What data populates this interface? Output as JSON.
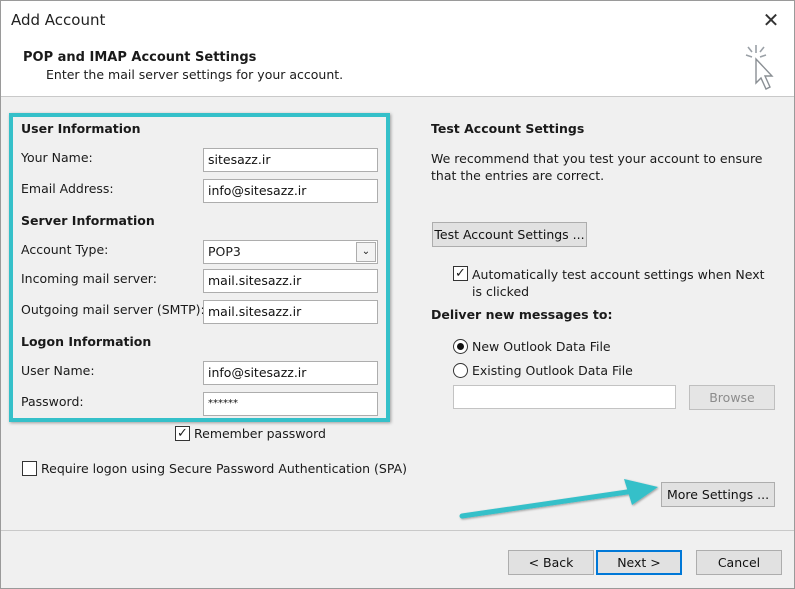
{
  "window": {
    "title": "Add Account"
  },
  "header": {
    "title": "POP and IMAP Account Settings",
    "subtitle": "Enter the mail server settings for your account."
  },
  "user_info": {
    "heading": "User Information",
    "name_label": "Your Name:",
    "name_value": "sitesazz.ir",
    "email_label": "Email Address:",
    "email_value": "info@sitesazz.ir"
  },
  "server_info": {
    "heading": "Server Information",
    "account_type_label": "Account Type:",
    "account_type_value": "POP3",
    "incoming_label": "Incoming mail server:",
    "incoming_value": "mail.sitesazz.ir",
    "outgoing_label": "Outgoing mail server (SMTP):",
    "outgoing_value": "mail.sitesazz.ir"
  },
  "logon_info": {
    "heading": "Logon Information",
    "username_label": "User Name:",
    "username_value": "info@sitesazz.ir",
    "password_label": "Password:",
    "password_value": "******",
    "remember_label": "Remember password",
    "spa_label": "Require logon using Secure Password Authentication (SPA)"
  },
  "test": {
    "heading": "Test Account Settings",
    "description": "We recommend that you test your account to ensure that the entries are correct.",
    "button_label": "Test Account Settings ...",
    "auto_test_label": "Automatically test account settings when Next is clicked"
  },
  "deliver": {
    "heading": "Deliver new messages to:",
    "option_new": "New Outlook Data File",
    "option_existing": "Existing Outlook Data File",
    "existing_path": "",
    "browse_label": "Browse"
  },
  "buttons": {
    "more_settings": "More Settings ...",
    "back": "< Back",
    "next": "Next >",
    "cancel": "Cancel"
  },
  "colors": {
    "highlight": "#35c0c9",
    "primary_border": "#0078d7"
  }
}
